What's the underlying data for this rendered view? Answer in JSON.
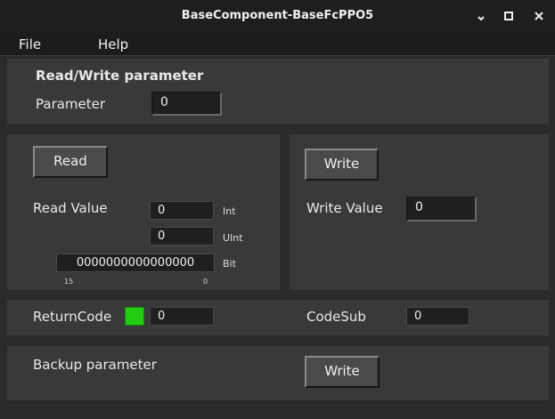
{
  "window": {
    "title": "BaseComponent-BaseFcPPO5"
  },
  "menu": {
    "file": "File",
    "help": "Help"
  },
  "param_section": {
    "heading": "Read/Write parameter",
    "parameter_label": "Parameter",
    "parameter_value": "0"
  },
  "read_section": {
    "button": "Read",
    "value_label": "Read Value",
    "int_value": "0",
    "int_label": "Int",
    "uint_value": "0",
    "uint_label": "UInt",
    "bit_value": "0000000000000000",
    "bit_label": "Bit",
    "bit_high": "15",
    "bit_low": "0"
  },
  "write_section": {
    "button": "Write",
    "value_label": "Write Value",
    "value": "0"
  },
  "status_section": {
    "return_code_label": "ReturnCode",
    "return_code_value": "0",
    "return_code_color": "#22cc11",
    "code_sub_label": "CodeSub",
    "code_sub_value": "0"
  },
  "backup_section": {
    "label": "Backup parameter",
    "button": "Write"
  }
}
